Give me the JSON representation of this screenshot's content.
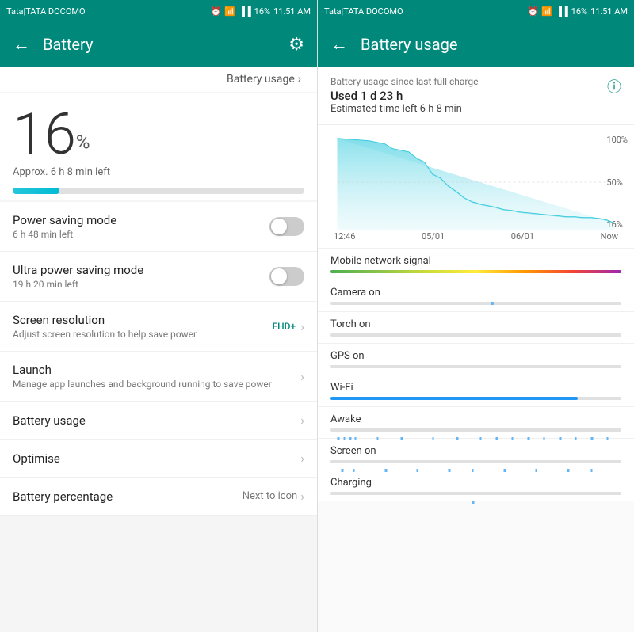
{
  "left_panel": {
    "status_bar": {
      "carrier": "Tata|TATA DOCOMO",
      "time": "11:51 AM",
      "battery_percent": "16%"
    },
    "header": {
      "title": "Battery",
      "back_label": "←",
      "settings_label": "⚙"
    },
    "battery_link": "Battery usage",
    "battery_level": "16",
    "battery_percent_symbol": "%",
    "battery_approx": "Approx. 6 h 8 min left",
    "settings": [
      {
        "title": "Power saving mode",
        "sub": "6 h 48 min left",
        "type": "toggle"
      },
      {
        "title": "Ultra power saving mode",
        "sub": "19 h 20 min left",
        "type": "toggle"
      },
      {
        "title": "Screen resolution",
        "sub": "Adjust screen resolution to help save power",
        "type": "fhd",
        "value": "FHD+"
      },
      {
        "title": "Launch",
        "sub": "Manage app launches and background running to save power",
        "type": "arrow"
      }
    ],
    "sections": [
      {
        "title": "Battery usage",
        "value": "",
        "type": "arrow"
      },
      {
        "title": "Optimise",
        "value": "",
        "type": "arrow"
      },
      {
        "title": "Battery percentage",
        "value": "Next to icon",
        "type": "arrow"
      }
    ]
  },
  "right_panel": {
    "status_bar": {
      "carrier": "Tata|TATA DOCOMO",
      "time": "11:51 AM",
      "battery_percent": "16%"
    },
    "header": {
      "title": "Battery usage",
      "back_label": "←"
    },
    "usage_since": "Battery usage since last full charge",
    "usage_used": "Used 1 d 23 h",
    "usage_estimated": "Estimated time left 6 h 8 min",
    "chart": {
      "labels_right": [
        "100%",
        "50%",
        "16%"
      ],
      "labels_time": [
        "12:46",
        "05/01",
        "06/01",
        "Now"
      ]
    },
    "usage_items": [
      {
        "label": "Mobile network signal",
        "type": "multicolor"
      },
      {
        "label": "Camera on",
        "type": "sparse"
      },
      {
        "label": "Torch on",
        "type": "empty"
      },
      {
        "label": "GPS on",
        "type": "empty"
      },
      {
        "label": "Wi-Fi",
        "type": "solid_blue"
      },
      {
        "label": "Awake",
        "type": "ticks_blue"
      },
      {
        "label": "Screen on",
        "type": "ticks_blue"
      },
      {
        "label": "Charging",
        "type": "sparse_center"
      }
    ]
  }
}
